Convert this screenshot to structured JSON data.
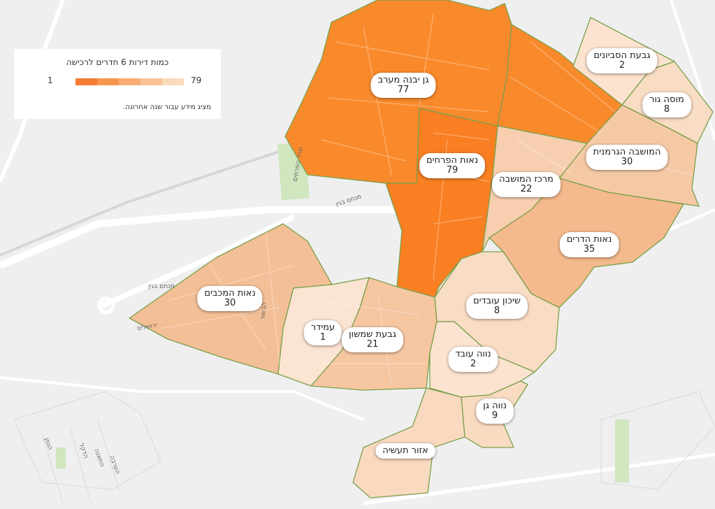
{
  "legend": {
    "title": "כמות דירות 6 חדרים לרכישה",
    "min": "1",
    "max": "79",
    "note": "מציג מידע עבור שנה אחרונה.",
    "colors": [
      "#fbd9bb",
      "#f9c397",
      "#f7ad73",
      "#f5964f",
      "#f47b34",
      "#f25a1e"
    ]
  },
  "neighborhoods": [
    {
      "name": "גן יבנה מערב",
      "value": "77",
      "color": "#f98a2c"
    },
    {
      "name": "נאות הפרחים",
      "value": "79",
      "color": "#f97f22"
    },
    {
      "name": "גבעת הסביונים",
      "value": "2",
      "color": "#fbe3d0"
    },
    {
      "name": "מוסה גור",
      "value": "8",
      "color": "#f9dcc4"
    },
    {
      "name": "המושבה הגרמנית",
      "value": "30",
      "color": "#f6c9a5"
    },
    {
      "name": "מרכז המושבה",
      "value": "22",
      "color": "#f7cfb0"
    },
    {
      "name": "נאות הדרים",
      "value": "35",
      "color": "#f4b98c"
    },
    {
      "name": "נאות המכבים",
      "value": "30",
      "color": "#f3bf96"
    },
    {
      "name": "שיכון עובדים",
      "value": "8",
      "color": "#f9dcc4"
    },
    {
      "name": "עמידר",
      "value": "1",
      "color": "#fbe4d2"
    },
    {
      "name": "גבעת שמשון",
      "value": "21",
      "color": "#f6c6a1"
    },
    {
      "name": "נווה עובד",
      "value": "2",
      "color": "#fbe3d0"
    },
    {
      "name": "נווה גן",
      "value": "9",
      "color": "#f9dbc2"
    },
    {
      "name": "אזור תעשיה",
      "value": "",
      "color": "#f9d9c0"
    }
  ],
  "streets": [
    "מנחם בגין",
    "מנחם בגין",
    "שדר הפרחים",
    "הבשור",
    "ירושלים",
    "הדקל",
    "התאנה",
    "הערבה",
    "הגפן"
  ]
}
